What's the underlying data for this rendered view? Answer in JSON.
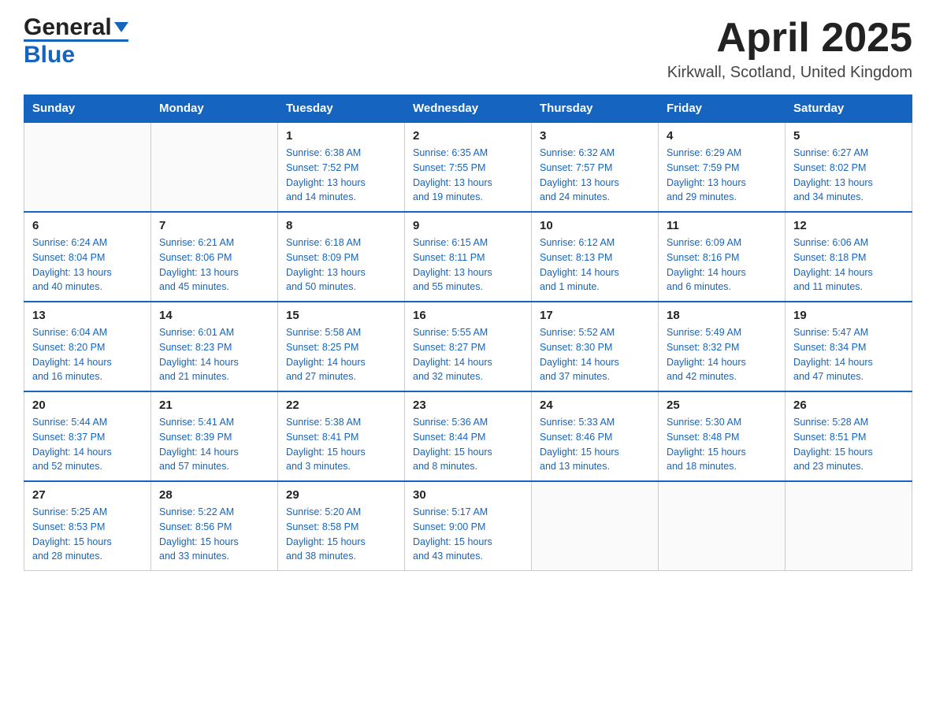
{
  "header": {
    "logo_text1": "General",
    "logo_text2": "Blue",
    "month_title": "April 2025",
    "location": "Kirkwall, Scotland, United Kingdom"
  },
  "weekdays": [
    "Sunday",
    "Monday",
    "Tuesday",
    "Wednesday",
    "Thursday",
    "Friday",
    "Saturday"
  ],
  "weeks": [
    [
      {
        "day": "",
        "info": ""
      },
      {
        "day": "",
        "info": ""
      },
      {
        "day": "1",
        "info": "Sunrise: 6:38 AM\nSunset: 7:52 PM\nDaylight: 13 hours\nand 14 minutes."
      },
      {
        "day": "2",
        "info": "Sunrise: 6:35 AM\nSunset: 7:55 PM\nDaylight: 13 hours\nand 19 minutes."
      },
      {
        "day": "3",
        "info": "Sunrise: 6:32 AM\nSunset: 7:57 PM\nDaylight: 13 hours\nand 24 minutes."
      },
      {
        "day": "4",
        "info": "Sunrise: 6:29 AM\nSunset: 7:59 PM\nDaylight: 13 hours\nand 29 minutes."
      },
      {
        "day": "5",
        "info": "Sunrise: 6:27 AM\nSunset: 8:02 PM\nDaylight: 13 hours\nand 34 minutes."
      }
    ],
    [
      {
        "day": "6",
        "info": "Sunrise: 6:24 AM\nSunset: 8:04 PM\nDaylight: 13 hours\nand 40 minutes."
      },
      {
        "day": "7",
        "info": "Sunrise: 6:21 AM\nSunset: 8:06 PM\nDaylight: 13 hours\nand 45 minutes."
      },
      {
        "day": "8",
        "info": "Sunrise: 6:18 AM\nSunset: 8:09 PM\nDaylight: 13 hours\nand 50 minutes."
      },
      {
        "day": "9",
        "info": "Sunrise: 6:15 AM\nSunset: 8:11 PM\nDaylight: 13 hours\nand 55 minutes."
      },
      {
        "day": "10",
        "info": "Sunrise: 6:12 AM\nSunset: 8:13 PM\nDaylight: 14 hours\nand 1 minute."
      },
      {
        "day": "11",
        "info": "Sunrise: 6:09 AM\nSunset: 8:16 PM\nDaylight: 14 hours\nand 6 minutes."
      },
      {
        "day": "12",
        "info": "Sunrise: 6:06 AM\nSunset: 8:18 PM\nDaylight: 14 hours\nand 11 minutes."
      }
    ],
    [
      {
        "day": "13",
        "info": "Sunrise: 6:04 AM\nSunset: 8:20 PM\nDaylight: 14 hours\nand 16 minutes."
      },
      {
        "day": "14",
        "info": "Sunrise: 6:01 AM\nSunset: 8:23 PM\nDaylight: 14 hours\nand 21 minutes."
      },
      {
        "day": "15",
        "info": "Sunrise: 5:58 AM\nSunset: 8:25 PM\nDaylight: 14 hours\nand 27 minutes."
      },
      {
        "day": "16",
        "info": "Sunrise: 5:55 AM\nSunset: 8:27 PM\nDaylight: 14 hours\nand 32 minutes."
      },
      {
        "day": "17",
        "info": "Sunrise: 5:52 AM\nSunset: 8:30 PM\nDaylight: 14 hours\nand 37 minutes."
      },
      {
        "day": "18",
        "info": "Sunrise: 5:49 AM\nSunset: 8:32 PM\nDaylight: 14 hours\nand 42 minutes."
      },
      {
        "day": "19",
        "info": "Sunrise: 5:47 AM\nSunset: 8:34 PM\nDaylight: 14 hours\nand 47 minutes."
      }
    ],
    [
      {
        "day": "20",
        "info": "Sunrise: 5:44 AM\nSunset: 8:37 PM\nDaylight: 14 hours\nand 52 minutes."
      },
      {
        "day": "21",
        "info": "Sunrise: 5:41 AM\nSunset: 8:39 PM\nDaylight: 14 hours\nand 57 minutes."
      },
      {
        "day": "22",
        "info": "Sunrise: 5:38 AM\nSunset: 8:41 PM\nDaylight: 15 hours\nand 3 minutes."
      },
      {
        "day": "23",
        "info": "Sunrise: 5:36 AM\nSunset: 8:44 PM\nDaylight: 15 hours\nand 8 minutes."
      },
      {
        "day": "24",
        "info": "Sunrise: 5:33 AM\nSunset: 8:46 PM\nDaylight: 15 hours\nand 13 minutes."
      },
      {
        "day": "25",
        "info": "Sunrise: 5:30 AM\nSunset: 8:48 PM\nDaylight: 15 hours\nand 18 minutes."
      },
      {
        "day": "26",
        "info": "Sunrise: 5:28 AM\nSunset: 8:51 PM\nDaylight: 15 hours\nand 23 minutes."
      }
    ],
    [
      {
        "day": "27",
        "info": "Sunrise: 5:25 AM\nSunset: 8:53 PM\nDaylight: 15 hours\nand 28 minutes."
      },
      {
        "day": "28",
        "info": "Sunrise: 5:22 AM\nSunset: 8:56 PM\nDaylight: 15 hours\nand 33 minutes."
      },
      {
        "day": "29",
        "info": "Sunrise: 5:20 AM\nSunset: 8:58 PM\nDaylight: 15 hours\nand 38 minutes."
      },
      {
        "day": "30",
        "info": "Sunrise: 5:17 AM\nSunset: 9:00 PM\nDaylight: 15 hours\nand 43 minutes."
      },
      {
        "day": "",
        "info": ""
      },
      {
        "day": "",
        "info": ""
      },
      {
        "day": "",
        "info": ""
      }
    ]
  ]
}
